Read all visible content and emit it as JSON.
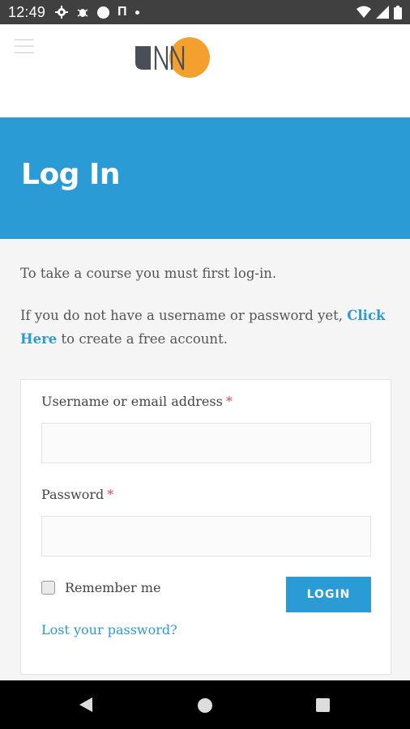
{
  "status_bar": {
    "time": "12:49",
    "icons_left": [
      "gear-icon",
      "bug-icon",
      "circle-icon",
      "pi-icon",
      "dot-icon"
    ],
    "pi_glyph": "Π",
    "icons_right": [
      "wifi-icon",
      "signal-icon",
      "battery-icon"
    ]
  },
  "header": {
    "logo": "UNN",
    "logo_colors": {
      "dark": "#4a4f57",
      "accent": "#f3a02e"
    }
  },
  "banner": {
    "title": "Log In"
  },
  "intro": {
    "line1": "To take a course you must first log-in.",
    "line2_prefix": "If you do not have a username or password yet, ",
    "line2_link": "Click Here",
    "line2_suffix": " to create a free account."
  },
  "form": {
    "username_label": "Username or email address",
    "password_label": "Password",
    "required_marker": "*",
    "username_value": "",
    "password_value": "",
    "remember_label": "Remember me",
    "remember_checked": false,
    "login_button": "LOGIN",
    "lost_password": "Lost your password?"
  },
  "colors": {
    "accent": "#2a9bd4",
    "required": "#e04b4b"
  },
  "nav_bar": {
    "buttons": [
      "back-icon",
      "home-icon",
      "recent-apps-icon"
    ]
  }
}
